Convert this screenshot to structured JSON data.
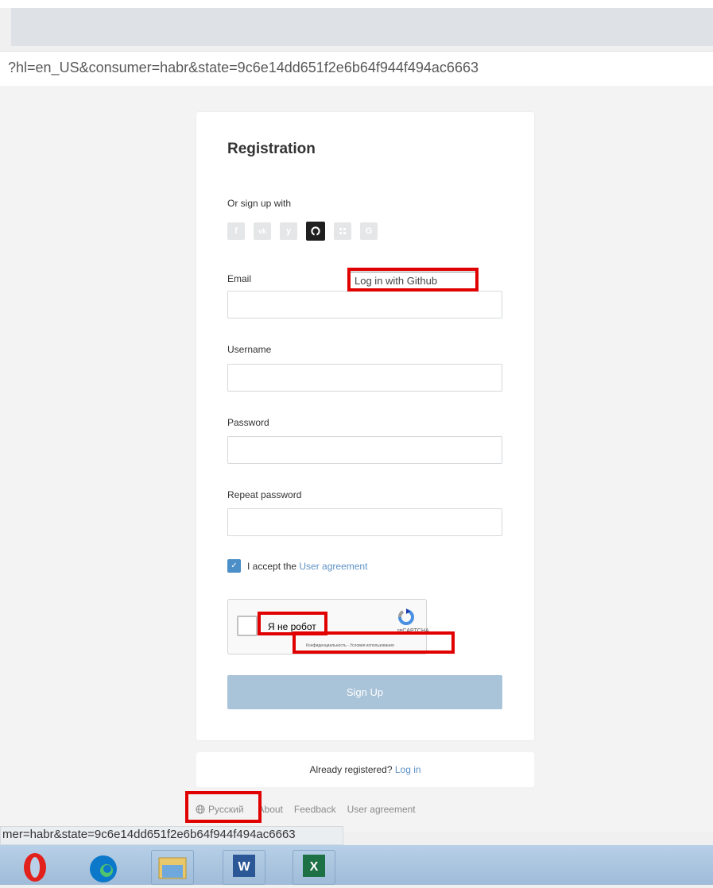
{
  "browser": {
    "url_text": "?hl=en_US&consumer=habr&state=9c6e14dd651f2e6b64f944f494ac6663",
    "status_url": "mer=habr&state=9c6e14dd651f2e6b64f944f494ac6663"
  },
  "form": {
    "title": "Registration",
    "social_label": "Or sign up with",
    "social_buttons": [
      {
        "glyph": "f",
        "icon": "facebook-icon"
      },
      {
        "glyph": "vk",
        "icon": "vk-icon"
      },
      {
        "glyph": "y",
        "icon": "twitter-icon"
      },
      {
        "glyph": "☺",
        "icon": "github-icon"
      },
      {
        "glyph": "▪",
        "icon": "live-icon"
      },
      {
        "glyph": "G",
        "icon": "google-icon"
      }
    ],
    "tooltip": "Log in with Github",
    "fields": {
      "email_label": "Email",
      "username_label": "Username",
      "password_label": "Password",
      "repeat_password_label": "Repeat password"
    },
    "accept_text": "I accept the ",
    "accept_link": "User agreement",
    "captcha": {
      "checkbox_label": "Я не робот",
      "brand": "reCAPTCHA",
      "terms": "Конфиденциальность - Условия использования"
    },
    "signup_label": "Sign Up"
  },
  "login_prompt": {
    "text": "Already registered? ",
    "link": "Log in"
  },
  "footer": {
    "language": "Русский",
    "about": "About",
    "feedback": "Feedback",
    "user_agreement": "User agreement"
  },
  "colors": {
    "accent_link": "#5e92c7",
    "signup_button": "#a9c3d8",
    "highlight": "#e00000"
  }
}
